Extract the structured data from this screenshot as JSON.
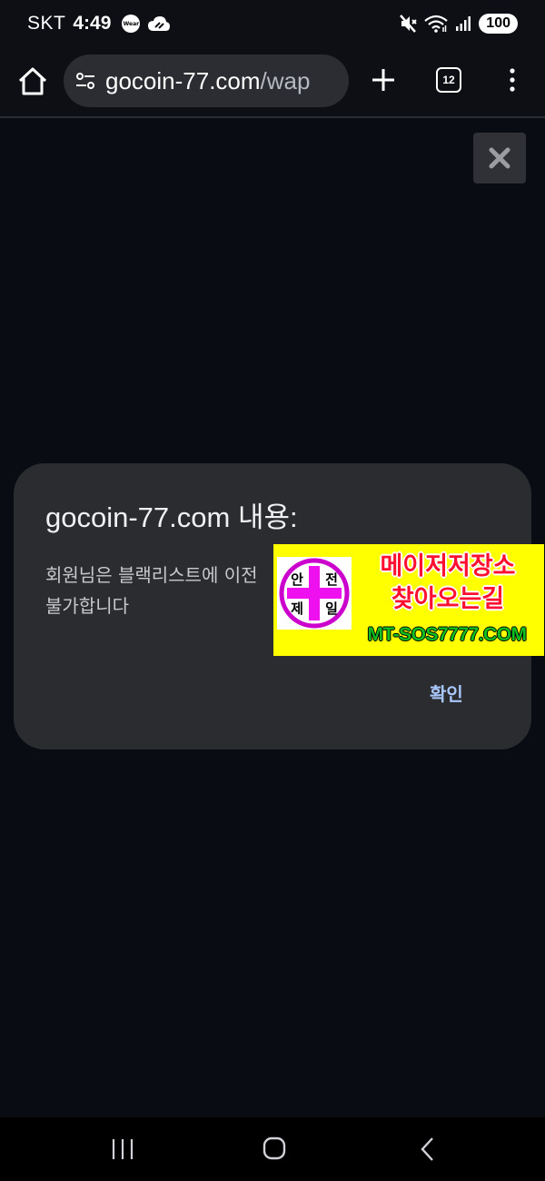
{
  "status_bar": {
    "carrier": "SKT",
    "time": "4:49",
    "wear_badge": "Wear",
    "battery": "100",
    "icons": [
      "wear-icon",
      "cloud-icon",
      "mute-icon",
      "wifi-icon",
      "signal-icon"
    ]
  },
  "toolbar": {
    "url_host": "gocoin-77.com",
    "url_path": "/wap",
    "tab_count": "12",
    "icons": [
      "home-icon",
      "site-settings-icon",
      "plus-icon",
      "tabs-icon",
      "more-vert-icon"
    ]
  },
  "dialog": {
    "title": "gocoin-77.com 내용:",
    "message_line1": "회원님은 블랙리스트에 이전",
    "message_line2": "불가합니다",
    "ok_label": "확인"
  },
  "banner": {
    "logo_chars": [
      "안",
      "전",
      "제",
      "일"
    ],
    "line1": "메이저저장소",
    "line2": "찾아오는길",
    "url": "MT-SOS7777.COM"
  },
  "colors": {
    "background": "#0a0c14",
    "dialog_bg": "#2b2c30",
    "accent": "#a8c7fa",
    "banner_yellow": "#ffff00",
    "banner_red": "#ff1030",
    "banner_green": "#10c020",
    "logo_magenta": "#cc00cc"
  }
}
